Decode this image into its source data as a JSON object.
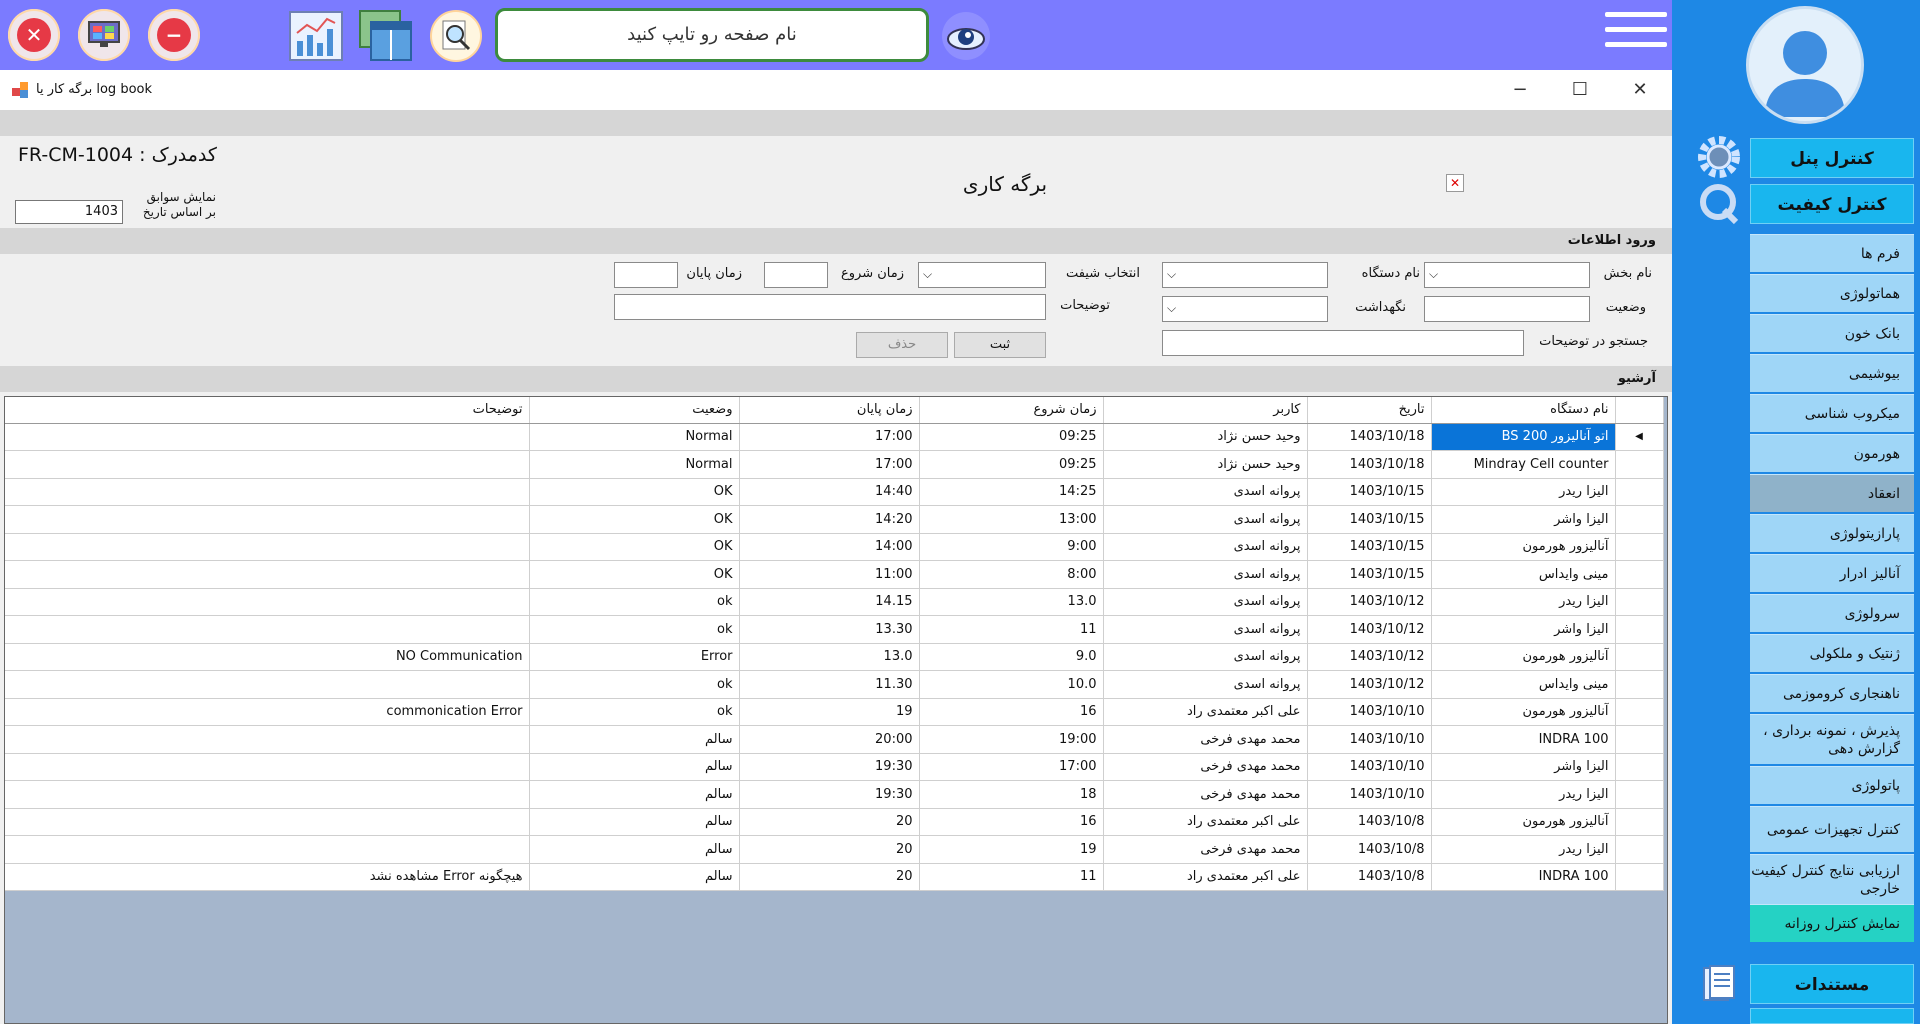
{
  "topbar": {
    "search_placeholder": "نام صفحه رو تایپ کنید",
    "icons": [
      "close-circle-icon",
      "monitor-icon",
      "minus-circle-icon",
      "chart-icon",
      "window-icon",
      "magnifier-icon",
      "eye-icon",
      "hamburger-menu-icon"
    ]
  },
  "window": {
    "title": "برگه کار یا log book",
    "code_label": "کدمدرک : FR-CM-1004",
    "page_title": "برگه کاری",
    "show_label_line1": "نمایش سوابق",
    "show_label_line2": "بر اساس تاریخ",
    "year_value": "1403"
  },
  "form": {
    "section_title": "ورود اطلاعات",
    "department_label": "نام بخش",
    "device_label": "نام دستگاه",
    "shift_label": "انتخاب شیفت",
    "start_label": "زمان شروع",
    "end_label": "زمان پایان",
    "status_label": "وضعیت",
    "maintenance_label": "نگهداشت",
    "notes_label": "توضیحات",
    "search_notes_label": "جستجو در توضیحات",
    "save_button": "ثبت",
    "delete_button": "حذف"
  },
  "archive": {
    "section_title": "آرشیو",
    "columns": [
      "نام دستگاه",
      "تاریخ",
      "کاربر",
      "زمان شروع",
      "زمان پایان",
      "وضعیت",
      "توضیحات"
    ],
    "rows": [
      [
        "اتو آنالیزور BS 200",
        "1403/10/18",
        "وحید حسن نژاد",
        "09:25",
        "17:00",
        "Normal",
        ""
      ],
      [
        "Mindray Cell counter",
        "1403/10/18",
        "وحید حسن نژاد",
        "09:25",
        "17:00",
        "Normal",
        ""
      ],
      [
        "الیزا ریدر",
        "1403/10/15",
        "پروانه اسدی",
        "14:25",
        "14:40",
        "OK",
        ""
      ],
      [
        "الیزا واشر",
        "1403/10/15",
        "پروانه اسدی",
        "13:00",
        "14:20",
        "OK",
        ""
      ],
      [
        "آنالیزور هورمون",
        "1403/10/15",
        "پروانه اسدی",
        "9:00",
        "14:00",
        "OK",
        ""
      ],
      [
        "مینی وایداس",
        "1403/10/15",
        "پروانه اسدی",
        "8:00",
        "11:00",
        "OK",
        ""
      ],
      [
        "الیزا ریدر",
        "1403/10/12",
        "پروانه اسدی",
        "13.0",
        "14.15",
        "ok",
        ""
      ],
      [
        "الیزا واشر",
        "1403/10/12",
        "پروانه اسدی",
        "11",
        "13.30",
        "ok",
        ""
      ],
      [
        "آنالیزور هورمون",
        "1403/10/12",
        "پروانه اسدی",
        "9.0",
        "13.0",
        "Error",
        "NO Communication"
      ],
      [
        "مینی وایداس",
        "1403/10/12",
        "پروانه اسدی",
        "10.0",
        "11.30",
        "ok",
        ""
      ],
      [
        "آنالیزور هورمون",
        "1403/10/10",
        "علی اکبر معتمدی راد",
        "16",
        "19",
        "ok",
        "commonication Error"
      ],
      [
        "INDRA 100",
        "1403/10/10",
        "محمد مهدی فرخی",
        "19:00",
        "20:00",
        "سالم",
        ""
      ],
      [
        "الیزا واشر",
        "1403/10/10",
        "محمد مهدی فرخی",
        "17:00",
        "19:30",
        "سالم",
        ""
      ],
      [
        "الیزا ریدر",
        "1403/10/10",
        "محمد مهدی فرخی",
        "18",
        "19:30",
        "سالم",
        ""
      ],
      [
        "آنالیزور هورمون",
        "1403/10/8",
        "علی اکبر معتمدی راد",
        "16",
        "20",
        "سالم",
        ""
      ],
      [
        "الیزا ریدر",
        "1403/10/8",
        "محمد مهدی فرخی",
        "19",
        "20",
        "سالم",
        ""
      ],
      [
        "INDRA 100",
        "1403/10/8",
        "علی اکبر معتمدی راد",
        "11",
        "20",
        "سالم",
        "هیچگونه Error مشاهده نشد"
      ]
    ]
  },
  "sidebar": {
    "control_panel": "کنترل پنل",
    "quality_control": "کنترل کیفیت",
    "items": [
      "فرم ها",
      "هماتولوژی",
      "بانک خون",
      "بیوشیمی",
      "میکروب شناسی",
      "هورمون",
      "انعقاد",
      "پارازیتولوژی",
      "آنالیز ادرار",
      "سرولوژی",
      "ژنتیک و ملکولی",
      "ناهنجاری کروموزمی",
      "پذیرش ، نمونه برداری ، گزارش دهی",
      "پاتولوژی",
      "کنترل تجهیزات عمومی",
      "ارزیابی نتایج کنترل کیفیت خارجی",
      "نمایش کنترل روزانه"
    ],
    "documents": "مستندات"
  },
  "colors": {
    "topbar": "#7b7bff",
    "sidebar": "#1e88e5",
    "selected_cell": "#0a74d8"
  }
}
